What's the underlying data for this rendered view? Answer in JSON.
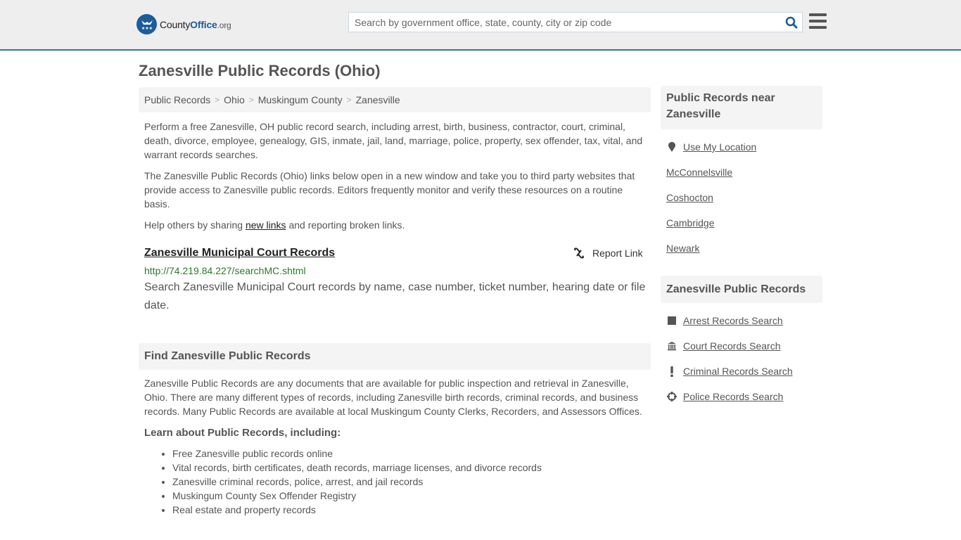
{
  "header": {
    "logo": {
      "county": "County",
      "office": "Office",
      "org": ".org",
      "icon": "eagle-stars-icon"
    },
    "search": {
      "placeholder": "Search by government office, state, county, city or zip code",
      "value": "",
      "icon": "search-icon"
    },
    "menu_icon": "hamburger-menu-icon"
  },
  "page": {
    "title": "Zanesville Public Records (Ohio)",
    "breadcrumb": [
      "Public Records",
      "Ohio",
      "Muskingum County",
      "Zanesville"
    ],
    "breadcrumb_separator": ">",
    "intro": {
      "p1": "Perform a free Zanesville, OH public record search, including arrest, birth, business, contractor, court, criminal, death, divorce, employee, genealogy, GIS, inmate, jail, land, marriage, police, property, sex offender, tax, vital, and warrant records searches.",
      "p2": "The Zanesville Public Records (Ohio) links below open in a new window and take you to third party websites that provide access to Zanesville public records. Editors frequently monitor and verify these resources on a routine basis.",
      "p3_before": "Help others by sharing ",
      "p3_link": "new links",
      "p3_after": " and reporting broken links."
    },
    "listing": {
      "title": "Zanesville Municipal Court Records",
      "url": "http://74.219.84.227/searchMC.shtml",
      "description": "Search Zanesville Municipal Court records by name, case number, ticket number, hearing date or file date.",
      "report_label": "Report Link",
      "report_icon": "broken-link-icon"
    },
    "find_section": {
      "title": "Find Zanesville Public Records",
      "body": "Zanesville Public Records are any documents that are available for public inspection and retrieval in Zanesville, Ohio. There are many different types of records, including Zanesville birth records, criminal records, and business records. Many Public Records are available at local Muskingum County Clerks, Recorders, and Assessors Offices.",
      "learn_title": "Learn about Public Records, including:",
      "learn_items": [
        "Free Zanesville public records online",
        "Vital records, birth certificates, death records, marriage licenses, and divorce records",
        "Zanesville criminal records, police, arrest, and jail records",
        "Muskingum County Sex Offender Registry",
        "Real estate and property records"
      ]
    }
  },
  "sidebar": {
    "nearby": {
      "title": "Public Records near Zanesville",
      "use_location": "Use My Location",
      "cities": [
        "McConnelsville",
        "Coshocton",
        "Cambridge",
        "Newark"
      ]
    },
    "records": {
      "title": "Zanesville Public Records",
      "items": [
        {
          "label": "Arrest Records Search",
          "icon": "square-icon"
        },
        {
          "label": "Court Records Search",
          "icon": "courthouse-icon"
        },
        {
          "label": "Criminal Records Search",
          "icon": "exclamation-icon"
        },
        {
          "label": "Police Records Search",
          "icon": "crosshair-icon"
        }
      ]
    }
  }
}
